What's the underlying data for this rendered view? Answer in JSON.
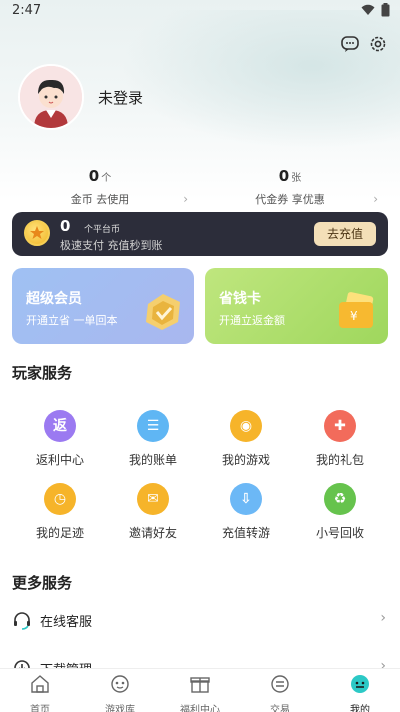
{
  "status": {
    "time": "2:47"
  },
  "profile": {
    "login_text": "未登录"
  },
  "stats": [
    {
      "num": "0",
      "unit": "个",
      "label": "金币 去使用"
    },
    {
      "num": "0",
      "unit": "张",
      "label": "代金券 享优惠"
    }
  ],
  "coins": {
    "num": "0",
    "unit": "个平台币",
    "sub": "极速支付 充值秒到账",
    "button": "去充值"
  },
  "cards": {
    "vip": {
      "title": "超级会员",
      "sub": "开通立省 一单回本"
    },
    "save": {
      "title": "省钱卡",
      "sub": "开通立返金额"
    }
  },
  "player_services": {
    "title": "玩家服务",
    "items": [
      {
        "label": "返利中心",
        "glyph": "返",
        "color": "#9b7af1",
        "icon": "rebate-icon"
      },
      {
        "label": "我的账单",
        "glyph": "☰",
        "color": "#5fb6f4",
        "icon": "bill-icon"
      },
      {
        "label": "我的游戏",
        "glyph": "◉",
        "color": "#f6b42a",
        "icon": "gamepad-icon"
      },
      {
        "label": "我的礼包",
        "glyph": "✚",
        "color": "#f26b5b",
        "icon": "gift-icon"
      },
      {
        "label": "我的足迹",
        "glyph": "◷",
        "color": "#f6b42a",
        "icon": "footprint-icon"
      },
      {
        "label": "邀请好友",
        "glyph": "✉",
        "color": "#f6b42a",
        "icon": "invite-icon"
      },
      {
        "label": "充值转游",
        "glyph": "⇩",
        "color": "#6cb8f6",
        "icon": "transfer-icon"
      },
      {
        "label": "小号回收",
        "glyph": "♻",
        "color": "#66c34d",
        "icon": "recycle-icon"
      }
    ]
  },
  "more_services": {
    "title": "更多服务",
    "items": [
      {
        "label": "在线客服",
        "icon": "headset-icon"
      },
      {
        "label": "下载管理",
        "icon": "download-icon"
      }
    ]
  },
  "tabbar": {
    "items": [
      {
        "label": "首页",
        "icon": "home-icon"
      },
      {
        "label": "游戏库",
        "icon": "game-library-icon"
      },
      {
        "label": "福利中心",
        "icon": "welfare-icon"
      },
      {
        "label": "交易",
        "icon": "trade-icon"
      },
      {
        "label": "我的",
        "icon": "profile-icon",
        "active": true
      }
    ]
  },
  "colors": {
    "accent": "#2cc9c6",
    "coinbar": "#2c2d3a",
    "recharge_button": "#f3dfb8"
  }
}
